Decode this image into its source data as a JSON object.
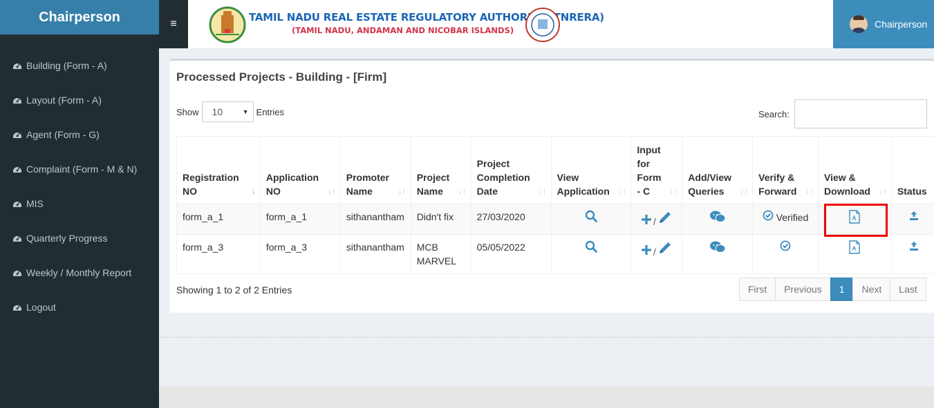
{
  "sidebar": {
    "brand": "Chairperson",
    "items": [
      {
        "label": "Building (Form - A)",
        "icon": "dashboard-icon"
      },
      {
        "label": "Layout (Form - A)",
        "icon": "dashboard-icon"
      },
      {
        "label": "Agent (Form - G)",
        "icon": "dashboard-icon"
      },
      {
        "label": "Complaint (Form - M & N)",
        "icon": "dashboard-icon"
      },
      {
        "label": "MIS",
        "icon": "dashboard-icon"
      },
      {
        "label": "Quarterly Progress",
        "icon": "dashboard-icon"
      },
      {
        "label": "Weekly / Monthly Report",
        "icon": "dashboard-icon"
      },
      {
        "label": "Logout",
        "icon": "dashboard-icon"
      }
    ]
  },
  "header": {
    "toggle": "≡",
    "title": "TAMIL NADU REAL ESTATE REGULATORY AUTHORITY (TNRERA)",
    "subtitle": "(TAMIL NADU, ANDAMAN AND NICOBAR ISLANDS)",
    "user": "Chairperson"
  },
  "box": {
    "title": "Processed Projects - Building - [Firm]",
    "show_label": "Show",
    "entries_label": "Entries",
    "page_size": "10",
    "search_label": "Search:",
    "search_value": ""
  },
  "table": {
    "headers": [
      [
        "Registration",
        "NO"
      ],
      [
        "Application",
        "NO"
      ],
      [
        "Promoter",
        "Name"
      ],
      [
        "Project",
        "Name"
      ],
      [
        "Project",
        "Completion",
        "Date"
      ],
      [
        "View",
        "Application"
      ],
      [
        "Input",
        "for",
        "Form",
        "- C"
      ],
      [
        "Add/View",
        "Queries"
      ],
      [
        "Verify &",
        "Forward"
      ],
      [
        "View &",
        "Download"
      ],
      [
        "Status"
      ]
    ],
    "rows": [
      {
        "reg_no": "form_a_1",
        "app_no": "form_a_1",
        "promoter": "sithanantham",
        "project": "Didn't fix",
        "date": "27/03/2020",
        "verify_text": "Verified"
      },
      {
        "reg_no": "form_a_3",
        "app_no": "form_a_3",
        "promoter": "sithanantham",
        "project": "MCB MARVEL",
        "date": "05/05/2022",
        "verify_text": ""
      }
    ]
  },
  "footer": {
    "info": "Showing 1 to 2 of 2 Entries",
    "pagination": [
      "First",
      "Previous",
      "1",
      "Next",
      "Last"
    ]
  },
  "colors": {
    "brand": "#367fa9",
    "accent": "#3c8dbc",
    "sidebar": "#222d32",
    "highlight": "#ee0000"
  }
}
